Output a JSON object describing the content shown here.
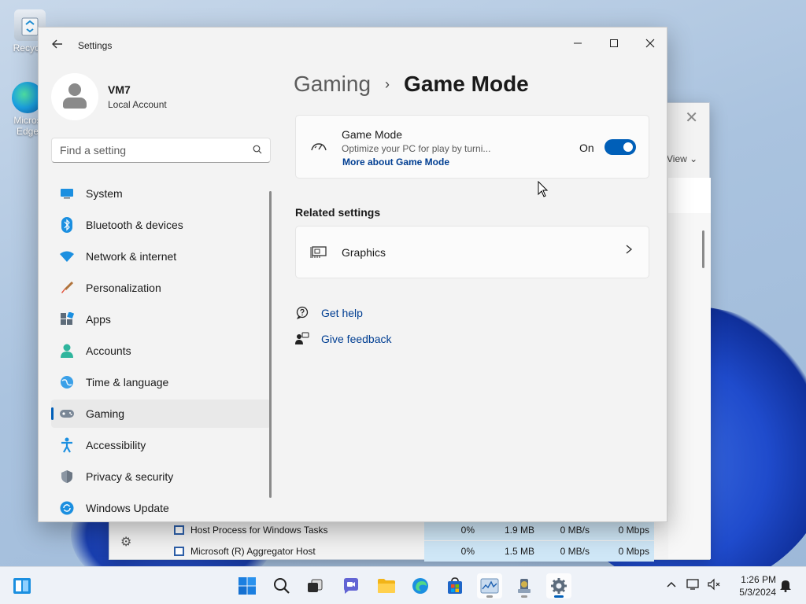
{
  "desktop": {
    "icons": [
      {
        "label": "Recycle",
        "icon": "recycle-bin-icon"
      },
      {
        "label": "Microsoft Edge",
        "line1": "Micros",
        "line2": "Edge",
        "icon": "edge-icon"
      }
    ]
  },
  "task_manager": {
    "view_label": "View",
    "rows": [
      {
        "name": "Host Process for Windows Tasks",
        "cpu": "0%",
        "memory": "1.9 MB",
        "disk": "0 MB/s",
        "network": "0 Mbps"
      },
      {
        "name": "Microsoft (R) Aggregator Host",
        "cpu": "0%",
        "memory": "1.5 MB",
        "disk": "0 MB/s",
        "network": "0 Mbps"
      }
    ]
  },
  "settings": {
    "window_title": "Settings",
    "profile": {
      "name": "VM7",
      "account_type": "Local Account"
    },
    "search": {
      "placeholder": "Find a setting"
    },
    "nav": [
      {
        "label": "System",
        "icon": "system-icon",
        "selected": false
      },
      {
        "label": "Bluetooth & devices",
        "icon": "bluetooth-icon",
        "selected": false
      },
      {
        "label": "Network & internet",
        "icon": "network-icon",
        "selected": false
      },
      {
        "label": "Personalization",
        "icon": "brush-icon",
        "selected": false
      },
      {
        "label": "Apps",
        "icon": "apps-icon",
        "selected": false
      },
      {
        "label": "Accounts",
        "icon": "accounts-icon",
        "selected": false
      },
      {
        "label": "Time & language",
        "icon": "globe-icon",
        "selected": false
      },
      {
        "label": "Gaming",
        "icon": "gamepad-icon",
        "selected": true
      },
      {
        "label": "Accessibility",
        "icon": "accessibility-icon",
        "selected": false
      },
      {
        "label": "Privacy & security",
        "icon": "shield-icon",
        "selected": false
      },
      {
        "label": "Windows Update",
        "icon": "update-icon",
        "selected": false
      }
    ],
    "breadcrumb": {
      "parent": "Gaming",
      "separator": "›",
      "current": "Game Mode"
    },
    "game_mode_card": {
      "title": "Game Mode",
      "description": "Optimize your PC for play by turni...",
      "link": "More about Game Mode",
      "state_label": "On",
      "enabled": true
    },
    "related_heading": "Related settings",
    "graphics_card": {
      "label": "Graphics"
    },
    "help_links": [
      {
        "label": "Get help",
        "icon": "get-help-icon"
      },
      {
        "label": "Give feedback",
        "icon": "feedback-icon"
      }
    ]
  },
  "taskbar": {
    "clock_time": "1:26 PM",
    "clock_date": "5/3/2024"
  },
  "colors": {
    "accent": "#005fb8",
    "link": "#003e92"
  }
}
